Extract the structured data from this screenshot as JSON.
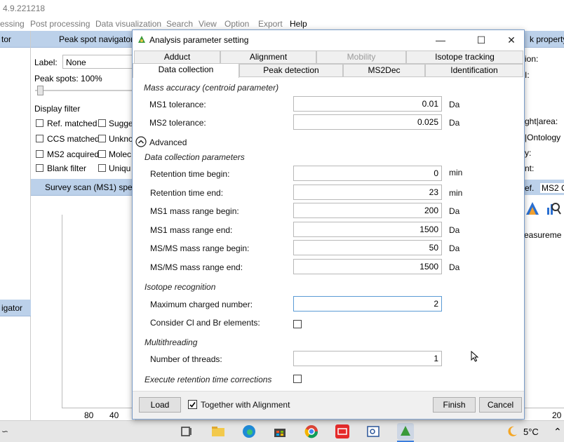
{
  "app": {
    "title_fragment": "4.9.221218",
    "menu": [
      {
        "label": "essing"
      },
      {
        "label": "Post processing"
      },
      {
        "label": "Data visualization"
      },
      {
        "label": "Search"
      },
      {
        "label": "View"
      },
      {
        "label": "Option"
      },
      {
        "label": "Export"
      },
      {
        "label": "Help"
      }
    ],
    "left_strip": {
      "header": "tor",
      "bottom_header": "igator"
    },
    "peak_nav": {
      "header": "Peak spot navigator",
      "label_caption": "Label:",
      "label_value": "None",
      "peak_spots": "Peak spots: 100%",
      "display_filter": "Display filter",
      "filters": [
        "Ref. matched",
        "Sugge",
        "CCS matched",
        "Unkno",
        "MS2 acquired",
        "Molec",
        "Blank filter",
        "Uniqu"
      ],
      "survey_header": "Survey scan (MS1) spect",
      "axis_ticks": [
        "80",
        "40"
      ]
    },
    "right_panel": {
      "header": "k property",
      "lines": [
        "ion:",
        "I:",
        "ght|area:",
        "|Ontology",
        "y:",
        "nt:"
      ],
      "tabs": [
        "ef.",
        "MS2 C"
      ],
      "measure": "easureme",
      "axis_tick": "20"
    }
  },
  "taskbar": {
    "weather": "5°C",
    "icons": [
      "task-view-icon",
      "file-explorer-icon",
      "edge-icon",
      "store-icon",
      "chrome-icon",
      "youdao-icon",
      "app-icon",
      "msdial-icon"
    ]
  },
  "dialog": {
    "title": "Analysis parameter setting",
    "tabs_row1": [
      {
        "label": "Adduct",
        "disabled": false
      },
      {
        "label": "Alignment",
        "disabled": false
      },
      {
        "label": "Mobility",
        "disabled": true
      },
      {
        "label": "Isotope tracking",
        "disabled": false
      }
    ],
    "tabs_row2": [
      {
        "label": "Data collection",
        "selected": true
      },
      {
        "label": "Peak detection"
      },
      {
        "label": "MS2Dec"
      },
      {
        "label": "Identification"
      }
    ],
    "mass_accuracy": {
      "section": "Mass accuracy (centroid parameter)",
      "ms1_label": "MS1 tolerance:",
      "ms1_value": "0.01",
      "ms1_unit": "Da",
      "ms2_label": "MS2 tolerance:",
      "ms2_value": "0.025",
      "ms2_unit": "Da"
    },
    "advanced_label": "Advanced",
    "collection": {
      "section": "Data collection parameters",
      "rows": [
        {
          "label": "Retention time begin:",
          "value": "0",
          "unit": "min"
        },
        {
          "label": "Retention time end:",
          "value": "23",
          "unit": "min"
        },
        {
          "label": "MS1 mass range begin:",
          "value": "200",
          "unit": "Da"
        },
        {
          "label": "MS1 mass range end:",
          "value": "1500",
          "unit": "Da"
        },
        {
          "label": "MS/MS mass range begin:",
          "value": "50",
          "unit": "Da"
        },
        {
          "label": "MS/MS mass range end:",
          "value": "1500",
          "unit": "Da"
        }
      ]
    },
    "isotope": {
      "section": "Isotope recognition",
      "max_charge_label": "Maximum charged number:",
      "max_charge_value": "2",
      "clbr_label": "Consider Cl and Br elements:",
      "clbr_checked": false
    },
    "multithreading": {
      "section": "Multithreading",
      "threads_label": "Number of threads:",
      "threads_value": "1"
    },
    "rt_correction": {
      "label": "Execute retention time corrections",
      "checked": false
    },
    "footer": {
      "load": "Load",
      "together_label": "Together with Alignment",
      "together_checked": true,
      "finish": "Finish",
      "cancel": "Cancel"
    }
  }
}
